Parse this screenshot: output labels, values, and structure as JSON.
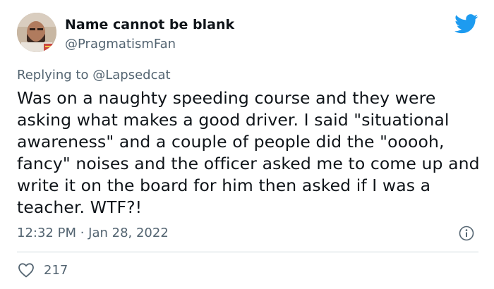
{
  "author": {
    "display_name": "Name cannot be blank",
    "handle": "@PragmatismFan"
  },
  "reply": {
    "prefix": "Replying to",
    "mention": "@Lapsedcat"
  },
  "tweet": {
    "text": "Was on a naughty speeding course and they were asking what makes a good driver. I said \"situational awareness\" and a couple of people did the \"ooooh, fancy\" noises and the officer asked me to come up and write it on the board for him then asked if I was a teacher. WTF?!",
    "timestamp": "12:32 PM · Jan 28, 2022"
  },
  "engagement": {
    "likes": "217"
  },
  "icons": {
    "brand": "twitter-bird-icon",
    "info": "info-icon",
    "like": "heart-icon"
  },
  "colors": {
    "brand_blue": "#1d9bf0",
    "secondary_text": "#536471",
    "primary_text": "#0f1419",
    "divider": "#cfd9de"
  }
}
